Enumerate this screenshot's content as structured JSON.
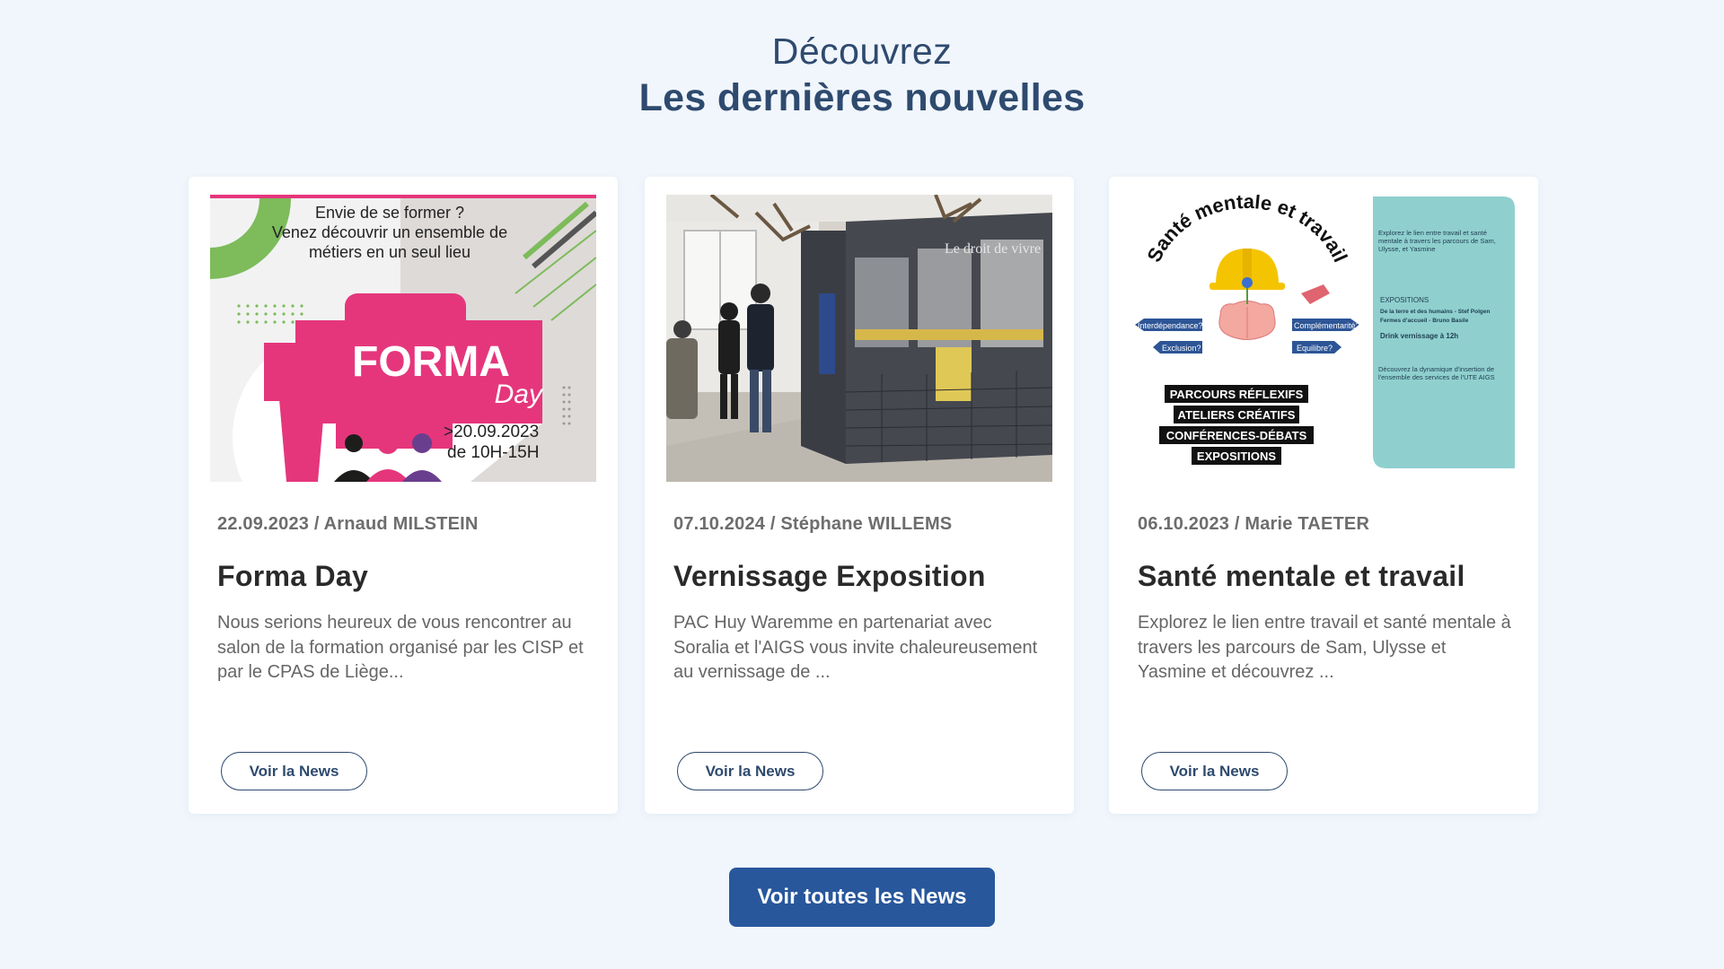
{
  "header": {
    "subtitle": "Découvrez",
    "title": "Les dernières nouvelles"
  },
  "colors": {
    "background": "#f1f6fd",
    "heading": "#2e4a6e",
    "primary_button": "#28579c",
    "forma_pink": "#e5367c",
    "forma_green": "#7dbb5b",
    "teal_panel": "#8fd0cf"
  },
  "cards": [
    {
      "meta": "22.09.2023 / Arnaud MILSTEIN",
      "title": "Forma Day",
      "excerpt": "Nous serions heureux de vous rencontrer au salon de la formation organisé par les CISP et par le CPAS de Liège...",
      "button": "Voir la News",
      "image": {
        "line1": "Envie de se former ?",
        "line2": "Venez découvrir un ensemble de",
        "line3": "métiers en un seul lieu",
        "brand": "FORMA",
        "brand_sub": "Day",
        "date": ">20.09.2023",
        "hours": "de 10H-15H"
      }
    },
    {
      "meta": "07.10.2024 / Stéphane WILLEMS",
      "title": "Vernissage Exposition",
      "excerpt": "PAC Huy Waremme en partenariat avec Soralia et l'AIGS vous invite chaleureusement au vernissage de ...",
      "button": "Voir la News",
      "image": {
        "panel_text": "Le droit de vivre"
      }
    },
    {
      "meta": "06.10.2023 / Marie TAETER",
      "title": "Santé mentale et travail",
      "excerpt": "Explorez le lien entre travail et santé mentale à travers les parcours de Sam, Ulysse et Yasmine et découvrez ...",
      "button": "Voir la News",
      "image": {
        "arc_title": "Santé mentale et travail",
        "tag1": "Interdépendance?",
        "tag2": "Complémentarité?",
        "tag3": "Exclusion?",
        "tag4": "Equilibre?",
        "label1": "PARCOURS RÉFLEXIFS",
        "label2": "ATELIERS CRÉATIFS",
        "label3": "CONFÉRENCES-DÉBATS",
        "label4": "EXPOSITIONS",
        "panel_intro": "Explorez le lien entre travail et santé mentale à travers les parcours de Sam, Ulysse, et Yasmine",
        "panel_expo": "EXPOSITIONS",
        "panel_expo1": "De la terre et des humains - Stef Polgen",
        "panel_expo2": "Fermes d'accueil - Bruno Basile",
        "panel_drink": "Drink vernissage à 12h",
        "panel_outro": "Découvrez la dynamique d'insertion de l'ensemble des services de l'UTE AIGS"
      }
    }
  ],
  "footer": {
    "all_news_button": "Voir toutes les News"
  }
}
